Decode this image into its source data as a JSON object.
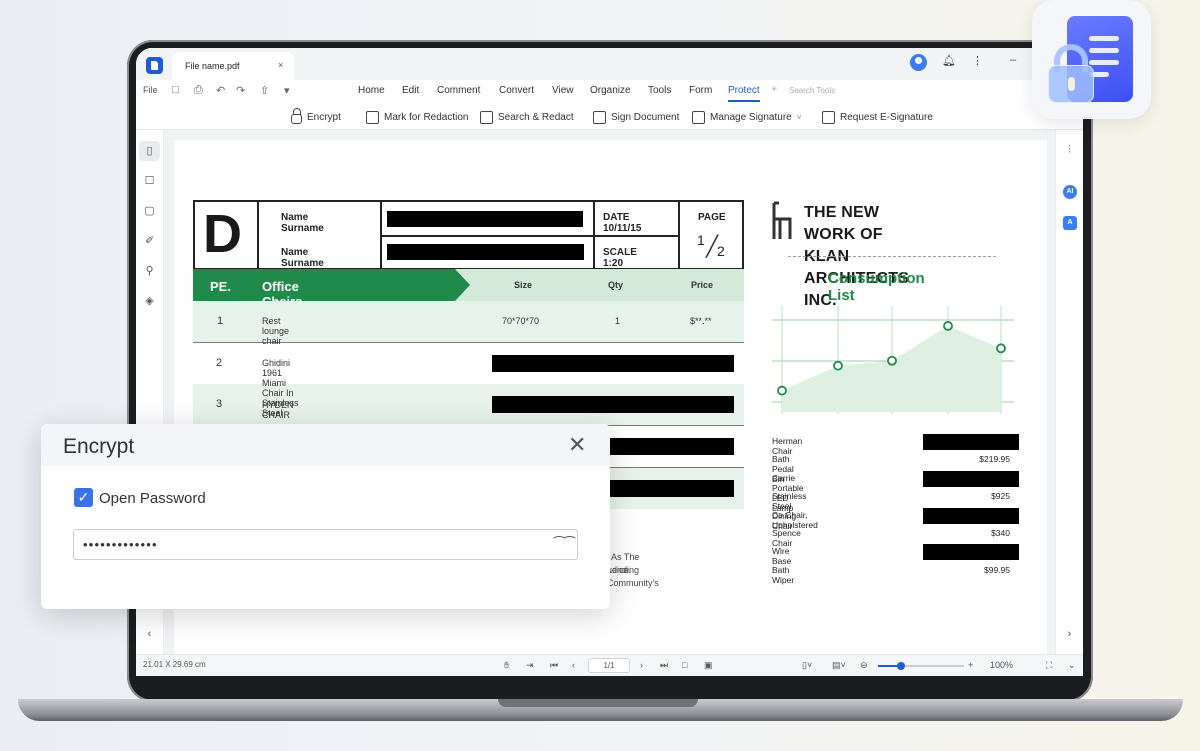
{
  "window": {
    "tab_title": "File name.pdf",
    "tab_close": "×"
  },
  "menu": {
    "file": "File",
    "items": [
      "Home",
      "Edit",
      "Comment",
      "Convert",
      "View",
      "Organize",
      "Tools",
      "Form",
      "Protect"
    ],
    "active": "Protect",
    "search_placeholder": "Search Tools"
  },
  "ribbon": {
    "encrypt": "Encrypt",
    "mark_for_redaction": "Mark for Redaction",
    "search_redact": "Search & Redact",
    "sign_document": "Sign Document",
    "manage_signature": "Manage Signature",
    "request_esignature": "Request E-Signature"
  },
  "document": {
    "header": {
      "logo_letter": "D",
      "name1": "Name Surname",
      "name2": "Name Surname",
      "date": "DATE 10/11/15",
      "scale": "SCALE 1:20",
      "page_label": "PAGE",
      "page_num": "1",
      "page_den": "2"
    },
    "table": {
      "pe_label": "PE.",
      "section_title": "Office Chairs and Design",
      "col_size": "Size",
      "col_qty": "Qty",
      "col_price": "Price",
      "rows": [
        {
          "num": "1",
          "name": "Rest lounge chair",
          "size": "70*70*70",
          "qty": "1",
          "price": "$**.**"
        },
        {
          "num": "2",
          "name": "Ghidini 1961 Miami Chair In Stainless Steel"
        },
        {
          "num": "3",
          "name": "HYDEN CHAIR"
        }
      ]
    },
    "firm_title_line1": "THE NEW WORK OF",
    "firm_title_line2": "KLAN ARCHITECTS INC.",
    "consumption_title": "Consumption List",
    "items": [
      {
        "name": "Herman Chair",
        "value": ""
      },
      {
        "name": "Bath Pedal Bin",
        "value": "$219.95"
      },
      {
        "name": "Carrie Portable LED Lamp",
        "value": ""
      },
      {
        "name": "Stainless Steel Dining Chair",
        "value": "$925"
      },
      {
        "name": "Co Chair, Upholstered",
        "value": ""
      },
      {
        "name": "Spence Chair",
        "value": "$340"
      },
      {
        "name": "Wire Base",
        "value": ""
      },
      {
        "name": "Bath Wiper",
        "value": "$99.95"
      }
    ],
    "footer_line1": "l As The Lending Community's",
    "footer_line2": "udice."
  },
  "chart_data": {
    "type": "area",
    "x": [
      1,
      2,
      3,
      4,
      5
    ],
    "values": [
      1,
      3,
      3.4,
      6.2,
      4.4
    ],
    "color": "#1f8a49"
  },
  "status": {
    "page_size": "21.01 X 29.69 cm",
    "page_indicator": "1/1",
    "zoom": "100%",
    "zoom_level": 0.27
  },
  "dialog": {
    "title": "Encrypt",
    "checkbox_label": "Open Password",
    "checkbox_checked": true,
    "password_value": "•••••••••••••"
  },
  "colors": {
    "accent": "#1f5bd6",
    "brand_green": "#1f8a49"
  }
}
